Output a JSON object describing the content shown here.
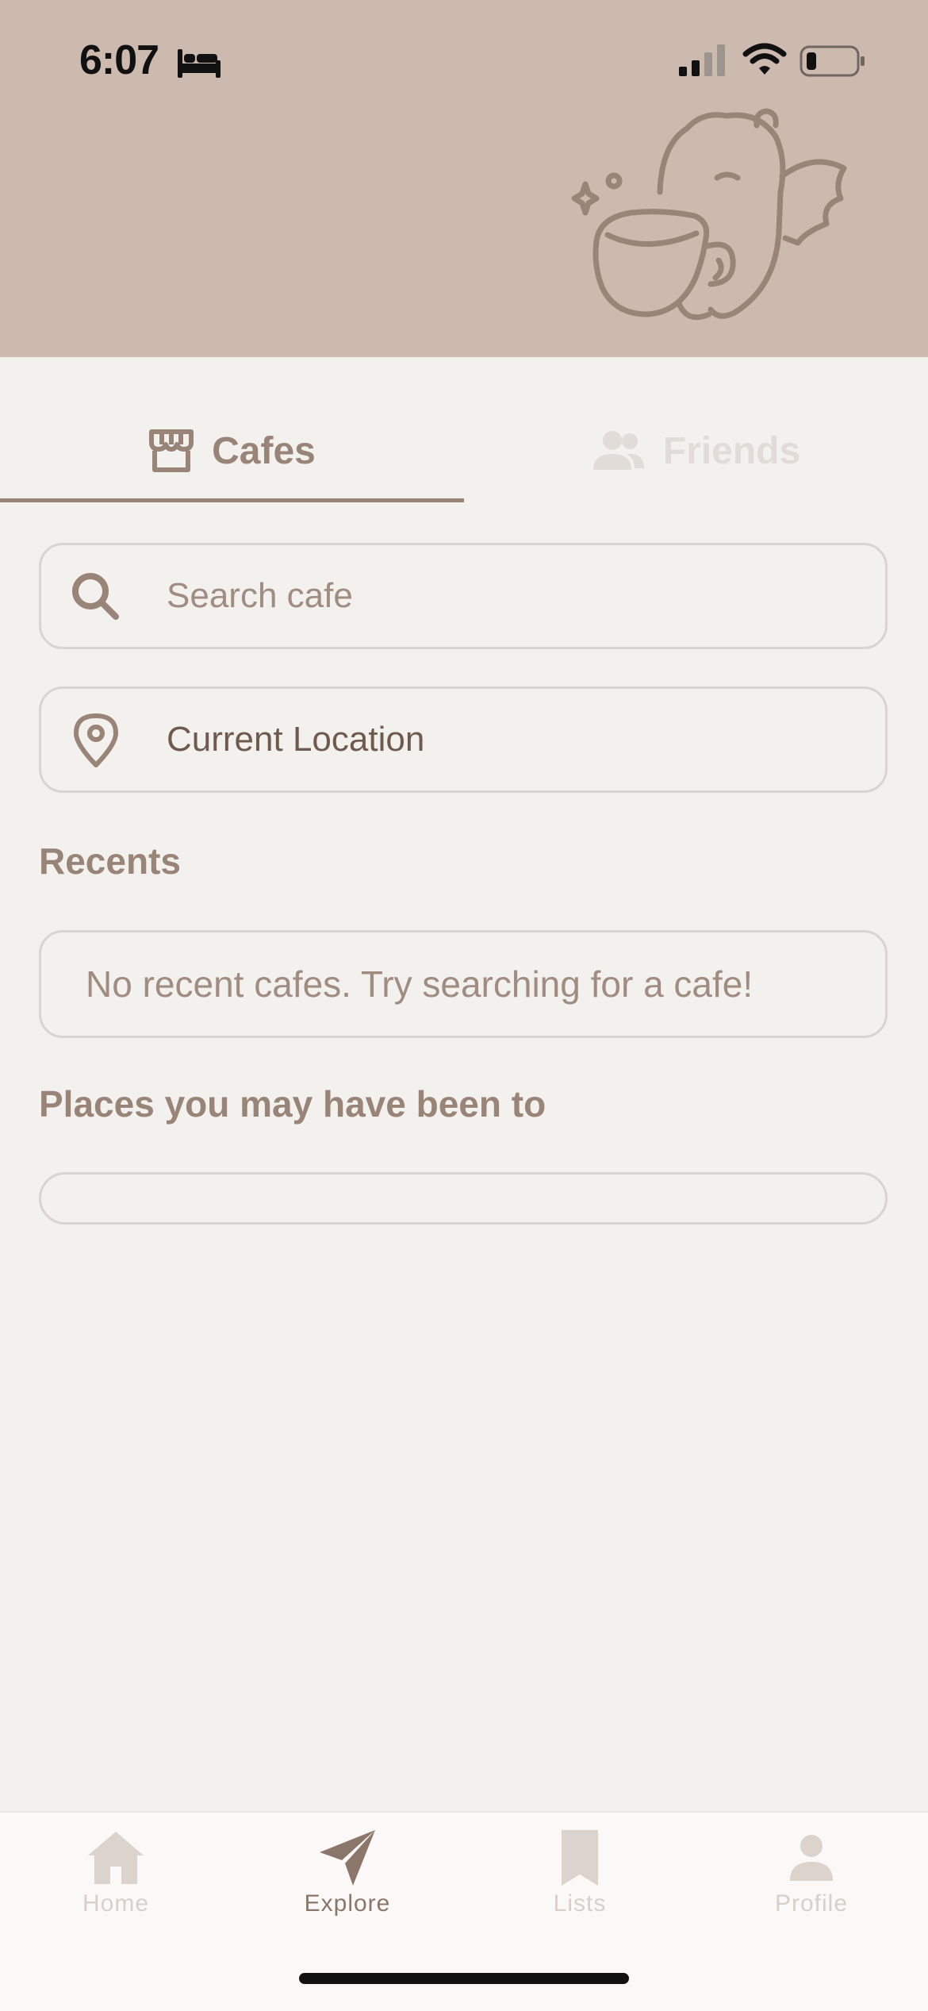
{
  "status_bar": {
    "time": "6:07"
  },
  "tabs": [
    {
      "label": "Cafes",
      "icon": "storefront-icon",
      "active": true
    },
    {
      "label": "Friends",
      "icon": "people-icon",
      "active": false
    }
  ],
  "search": {
    "placeholder": "Search cafe",
    "icon": "search-icon"
  },
  "location": {
    "value": "Current Location",
    "icon": "location-pin-icon"
  },
  "recents": {
    "title": "Recents",
    "empty_message": "No recent cafes. Try searching for a cafe!"
  },
  "places": {
    "title": "Places you may have been to"
  },
  "tab_bar": [
    {
      "label": "Home",
      "icon": "house-icon",
      "active": false
    },
    {
      "label": "Explore",
      "icon": "paper-plane-icon",
      "active": true
    },
    {
      "label": "Lists",
      "icon": "bookmark-icon",
      "active": false
    },
    {
      "label": "Profile",
      "icon": "person-icon",
      "active": false
    }
  ],
  "colors": {
    "header": "#CCBAAF",
    "background": "#F3F1ED",
    "accent": "#998478",
    "inactive": "#D8CFC9"
  }
}
